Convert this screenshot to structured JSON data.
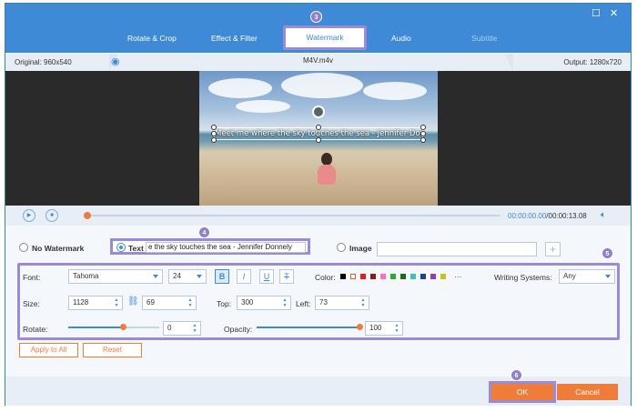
{
  "tabs": [
    "Rotate & Crop",
    "Effect & Filter",
    "Watermark",
    "Audio",
    "Subtitle"
  ],
  "badges": {
    "tab": "3",
    "text": "4",
    "options": "5",
    "ok": "6"
  },
  "info": {
    "original": "Original: 960x540",
    "filename": "M4V.m4v",
    "output": "Output: 1280x720"
  },
  "preview": {
    "watermark_text": "Meet me where the sky touches the sea - Jennifer Donnelly"
  },
  "playback": {
    "current": "00:00:00.00",
    "total": "/00:00:13.08"
  },
  "mode": {
    "no_watermark": "No Watermark",
    "text_label": "Text",
    "text_value": "e the sky touches the sea - Jennifer Donnely",
    "image_label": "Image",
    "image_value": "",
    "plus": "+"
  },
  "font": {
    "label": "Font:",
    "family": "Tahoma",
    "size": "24",
    "bold": "B",
    "italic": "I",
    "underline": "U",
    "strike": "T",
    "color_label": "Color:",
    "more": "···",
    "writing_label": "Writing Systems:",
    "writing_value": "Any"
  },
  "colors": [
    "#000000",
    "#ffffff",
    "#e02020",
    "#8b1a1a",
    "#ff6fb5",
    "#2eaa2e",
    "#1a6b1a",
    "#3cc0c0",
    "#1f3fa0",
    "#8a40c0",
    "#c8c020"
  ],
  "size": {
    "label": "Size:",
    "width": "1128",
    "height": "69",
    "top_label": "Top:",
    "top": "300",
    "left_label": "Left:",
    "left": "73"
  },
  "rotate": {
    "label": "Rotate:",
    "value": "0",
    "fraction": 0.6
  },
  "opacity": {
    "label": "Opacity:",
    "value": "100",
    "fraction": 1.0
  },
  "buttons": {
    "apply_all": "Apply to All",
    "reset": "Reset",
    "ok": "OK",
    "cancel": "Cancel"
  }
}
